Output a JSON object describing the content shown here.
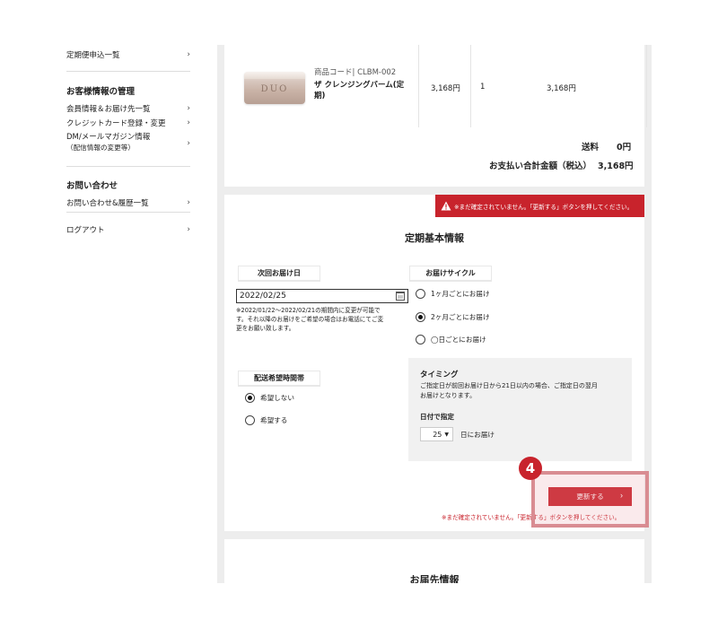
{
  "sidebar": {
    "regular_apply": "定期便申込一覧",
    "customer_heading": "お客様情報の管理",
    "member_info": "会員情報＆お届け先一覧",
    "credit_card": "クレジットカード登録・変更",
    "dm_line1": "DM/メールマガジン情報",
    "dm_line2": "（配信情報の変更等）",
    "contact_heading": "お問い合わせ",
    "contact_history": "お問い合わせ&履歴一覧",
    "logout": "ログアウト",
    "chevron": "›"
  },
  "order": {
    "product_code": "商品コード| CLBM-002",
    "product_name_line1": "ザ クレンジングバーム(定",
    "product_name_line2": "期)",
    "product_logo": "DUO",
    "unit_price": "3,168円",
    "quantity": "1",
    "subtotal": "3,168円",
    "shipping_label": "送料",
    "shipping_value": "0円",
    "total_label": "お支払い合計金額（税込）",
    "total_value": "3,168円"
  },
  "regular": {
    "alert_top": "※まだ確定されていません。「更新する」ボタンを押してください。",
    "title": "定期基本情報",
    "next_delivery_label": "次回お届け日",
    "next_delivery_value": "2022/02/25",
    "note_line1": "※2022/01/22〜2022/02/21の期間内に変更が可能で",
    "note_line2": "す。それ以降のお届けをご希望の場合はお電話にてご変",
    "note_line3": "更をお願い致します。",
    "cycle_label": "お届けサイクル",
    "cycle_options": [
      "1ヶ月ごとにお届け",
      "2ヶ月ごとにお届け",
      "◯日ごとにお届け"
    ],
    "cycle_selected": 1,
    "time_label": "配送希望時間帯",
    "time_options": [
      "希望しない",
      "希望する"
    ],
    "time_selected": 0,
    "timing_title": "タイミング",
    "timing_desc_line1": "ご指定日が前回お届け日から21日以内の場合、ご指定日の翌月",
    "timing_desc_line2": "お届けとなります。",
    "date_spec_label": "日付で指定",
    "day_value": "25",
    "day_unit": "日にお届け",
    "update_button": "更新する",
    "alert_bottom": "※まだ確定されていません。「更新する」ボタンを押してください。"
  },
  "shipping": {
    "title": "お届先情報"
  },
  "annotation": {
    "step": "4",
    "accent": "#c8232c"
  }
}
